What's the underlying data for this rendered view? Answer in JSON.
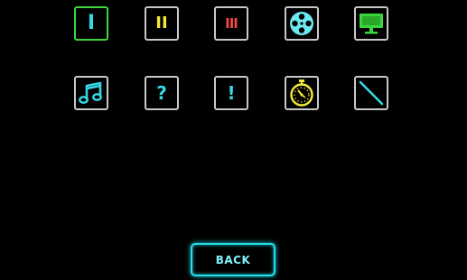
{
  "menu": {
    "items": [
      {
        "glyph": "I",
        "icon": "roman-numeral-one-icon",
        "color": "#37d8e6",
        "selected": true
      },
      {
        "glyph": "II",
        "icon": "roman-numeral-two-icon",
        "color": "#f2ea3a"
      },
      {
        "glyph": "III",
        "icon": "roman-numeral-three-icon",
        "color": "#f04848"
      },
      {
        "icon": "film-reel-icon",
        "color": "#6fe8f2"
      },
      {
        "icon": "monitor-icon",
        "color": "#3ad63a"
      },
      {
        "icon": "music-note-icon",
        "color": "#37d8e6"
      },
      {
        "glyph": "?",
        "icon": "question-mark-icon",
        "color": "#37d8e6"
      },
      {
        "glyph": "!",
        "icon": "exclamation-mark-icon",
        "color": "#37d8e6"
      },
      {
        "icon": "stopwatch-icon",
        "color": "#f2ea3a"
      },
      {
        "icon": "diagonal-line-icon",
        "color": "#37d8e6"
      }
    ]
  },
  "back_button": {
    "label": "BACK",
    "color": "#27e0ea"
  }
}
